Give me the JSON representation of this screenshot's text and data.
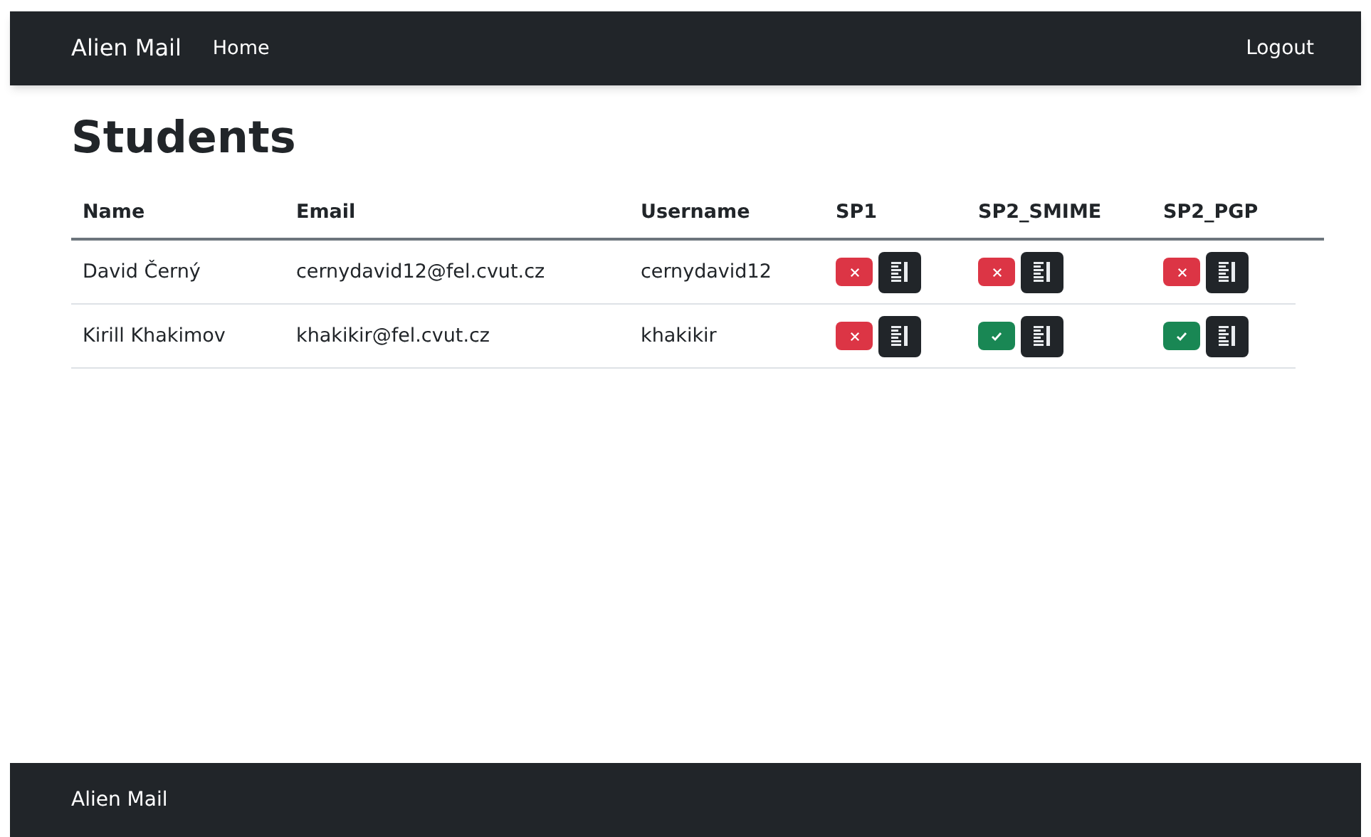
{
  "navbar": {
    "brand": "Alien Mail",
    "links": [
      "Home"
    ],
    "logout": "Logout"
  },
  "heading": "Students",
  "table": {
    "columns": [
      "Name",
      "Email",
      "Username",
      "SP1",
      "SP2_SMIME",
      "SP2_PGP"
    ],
    "rows": [
      {
        "name": "David Černý",
        "email": "cernydavid12@fel.cvut.cz",
        "username": "cernydavid12",
        "results": [
          {
            "passed": false
          },
          {
            "passed": false
          },
          {
            "passed": false
          }
        ]
      },
      {
        "name": "Kirill Khakimov",
        "email": "khakikir@fel.cvut.cz",
        "username": "khakikir",
        "results": [
          {
            "passed": false
          },
          {
            "passed": true
          },
          {
            "passed": true
          }
        ]
      }
    ]
  },
  "footer": {
    "brand": "Alien Mail"
  }
}
